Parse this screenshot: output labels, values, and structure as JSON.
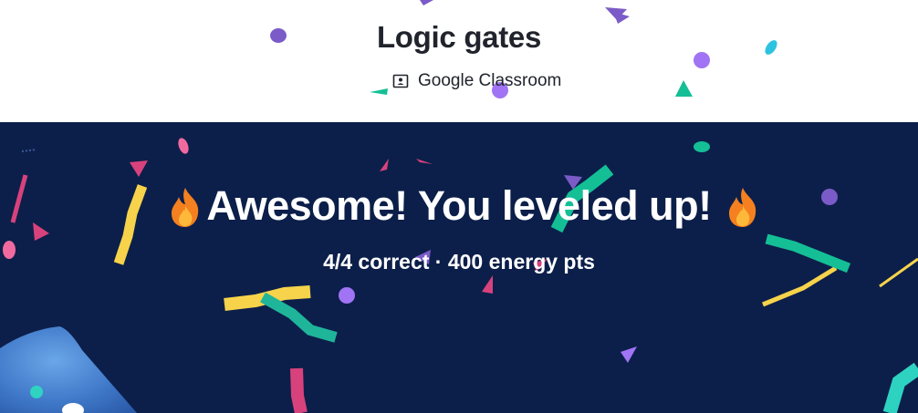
{
  "header": {
    "title": "Logic gates",
    "classroom_label": "Google Classroom"
  },
  "banner": {
    "headline": "Awesome! You leveled up!",
    "stats": "4/4 correct · 400 energy pts"
  },
  "icons": {
    "classroom": "google-classroom-icon",
    "flame": "fire-emoji"
  },
  "colors": {
    "banner_bg": "#0c1f4a",
    "title_text": "#21242c",
    "confetti": [
      "#f6d34b",
      "#14bf96",
      "#a074f5",
      "#d8427c",
      "#7b5bc7",
      "#2dc2b5"
    ]
  }
}
